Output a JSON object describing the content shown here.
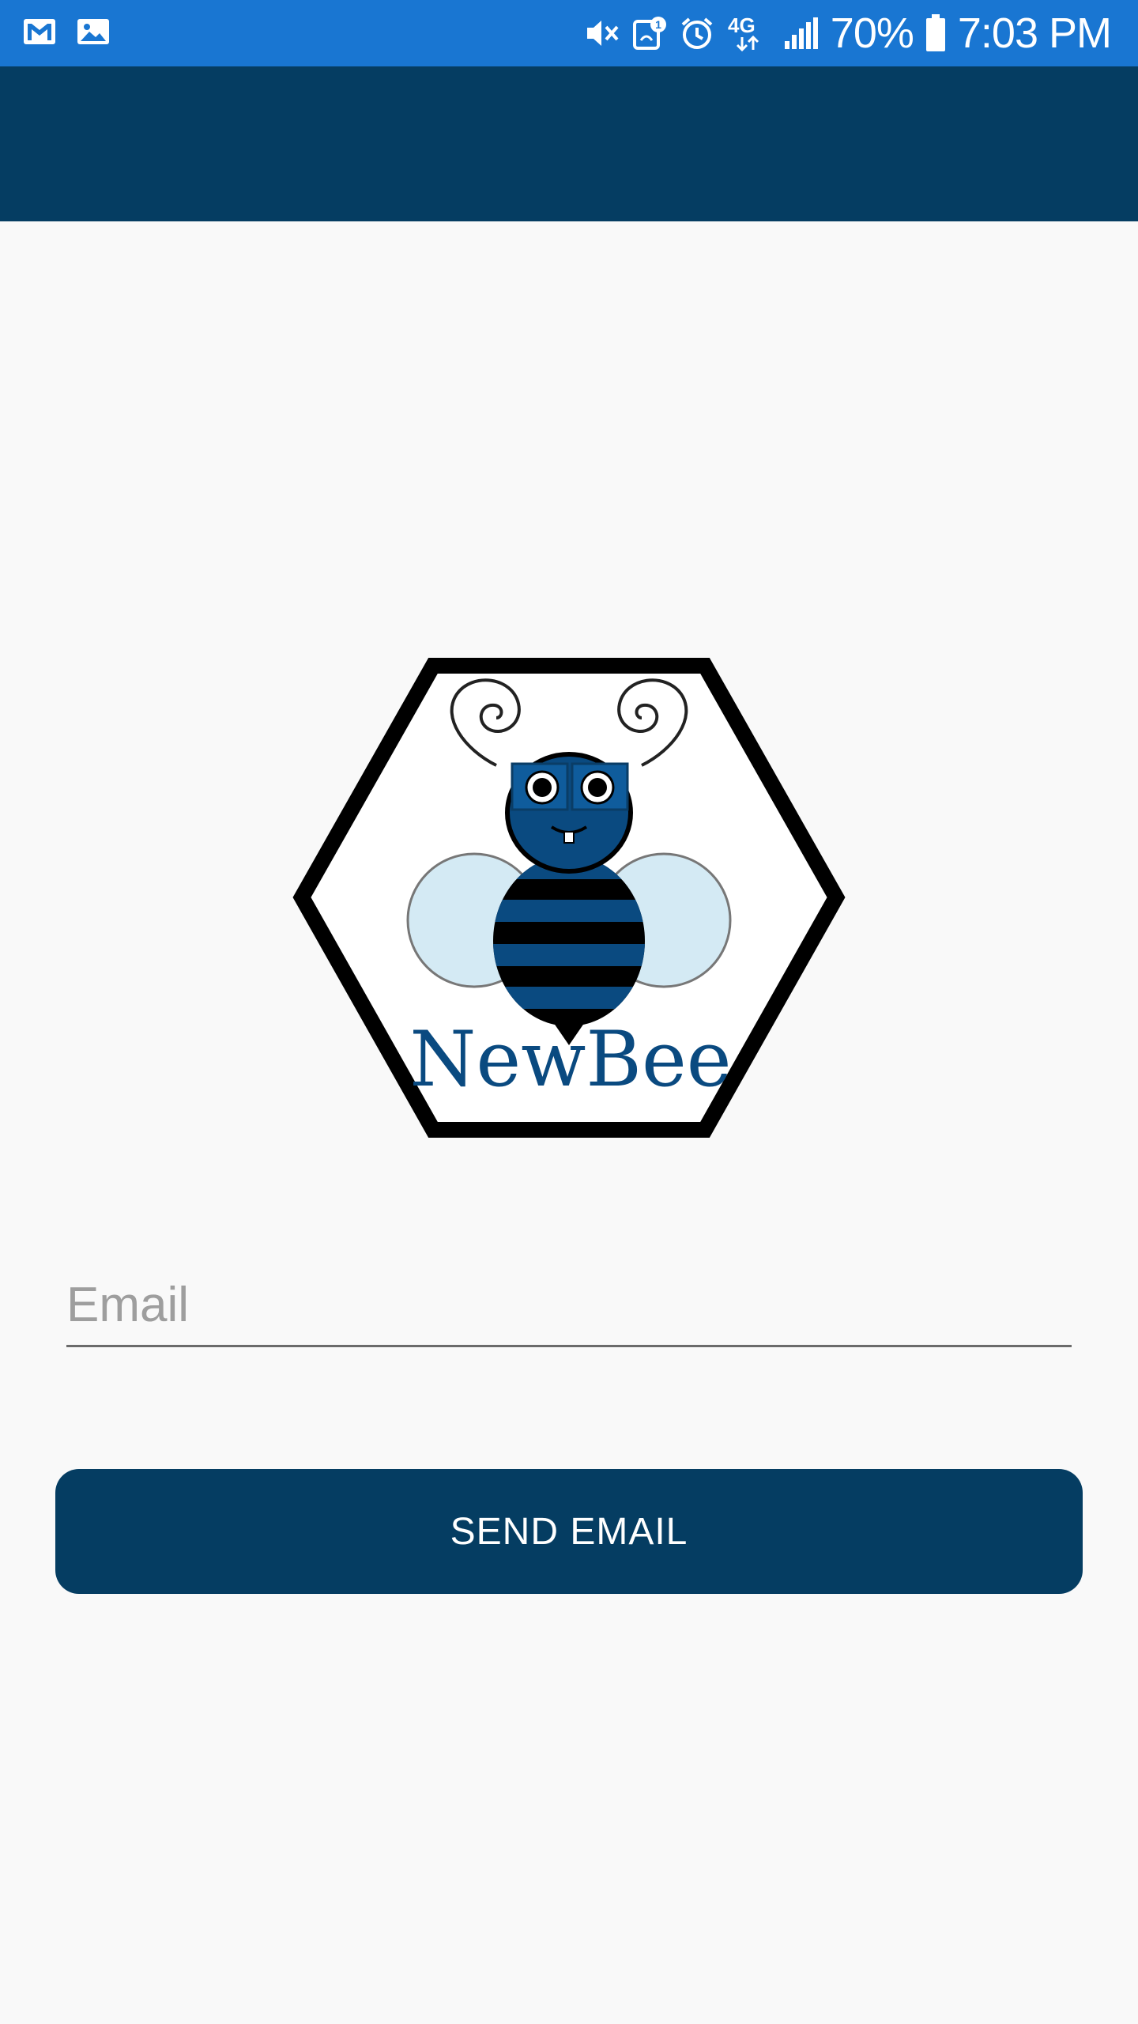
{
  "status_bar": {
    "battery": "70%",
    "time": "7:03 PM",
    "network": "4G",
    "icons": [
      "gmail-icon",
      "gallery-icon",
      "mute-icon",
      "hotspot-icon",
      "alarm-icon",
      "network-4g-icon",
      "signal-icon",
      "battery-icon"
    ],
    "background_color": "#1976d2"
  },
  "app_bar": {
    "background_color": "#053d62"
  },
  "logo": {
    "text": "NewBee",
    "colors": {
      "body_blue": "#0a4a80",
      "wings": "#d4eaf4",
      "outline": "#000000"
    }
  },
  "form": {
    "email_placeholder": "Email",
    "email_value": ""
  },
  "button": {
    "label": "SEND EMAIL",
    "background_color": "#053d62"
  }
}
